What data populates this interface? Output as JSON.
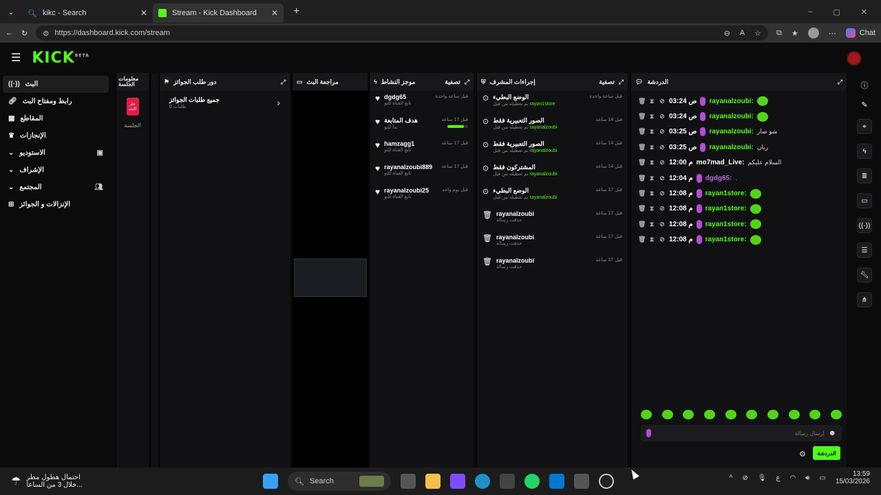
{
  "browser": {
    "tabs": [
      {
        "title": "kikc - Search",
        "active": false
      },
      {
        "title": "Stream - Kick Dashboard",
        "active": true
      }
    ],
    "url": "https://dashboard.kick.com/stream",
    "chat_label": "Chat"
  },
  "app": {
    "logo": "KICK",
    "logo_badge": "BETA",
    "nav": [
      {
        "label": "البث",
        "icon": "broadcast-icon",
        "active": true
      },
      {
        "label": "رابط ومفتاح البث",
        "icon": "link-icon"
      },
      {
        "label": "المقاطع",
        "icon": "clips-icon"
      },
      {
        "label": "الإنجازات",
        "icon": "trophy-icon"
      },
      {
        "label": "الاستوديو",
        "icon": "chevron-down-icon",
        "trail": "studio-icon"
      },
      {
        "label": "الإشراف",
        "icon": "chevron-down-icon"
      },
      {
        "label": "المجتمع",
        "icon": "chevron-down-icon",
        "trail": "users-icon"
      },
      {
        "label": "الإنزالات و الجوائز",
        "icon": "drops-icon"
      }
    ],
    "session_panel": {
      "title": "معلومات الجلسة",
      "badge": "حار البث",
      "label": "الجلسة"
    },
    "rewards_panel": {
      "title": "دور طلب الجوائز",
      "item_title": "جميع طلبات الجوائز",
      "item_sub": "0 طلبات"
    },
    "preview_panel": {
      "title": "مراجعة البث"
    },
    "activity_panel": {
      "title": "موجز النشاط",
      "filter": "تصفية",
      "items": [
        {
          "name": "dgdg65",
          "sub": "تابع القناة للتو",
          "time": "قبل ساعة واحدة"
        },
        {
          "name": "هدف المتابعة",
          "sub": "بدأ للتو",
          "time": "قبل 17 ساعة",
          "progress": 0.8
        },
        {
          "name": "hamzagg1",
          "sub": "تابع القناة للتو",
          "time": "قبل 17 ساعة"
        },
        {
          "name": "rayanalzoubi889",
          "sub": "تابع القناة للتو",
          "time": "قبل 17 ساعة"
        },
        {
          "name": "rayanalzoubi25",
          "sub": "تابع القناة للتو",
          "time": "قبل يوم واحد"
        }
      ]
    },
    "mod_panel": {
      "title": "إجراءات المشرف",
      "filter": "تصفية",
      "items": [
        {
          "title": "الوضع البطيء",
          "sub": "تم تعطيله من قبل",
          "user": "rayan1store",
          "time": "قبل ساعة واحدة"
        },
        {
          "title": "الصور التعبيرية فقط",
          "sub": "تم تعطيله من قبل",
          "user": "rayanalzoubi",
          "time": "قبل 14 ساعة"
        },
        {
          "title": "الصور التعبيرية فقط",
          "sub": "تم تعطيله من قبل",
          "user": "rayanalzoubi",
          "time": "قبل 14 ساعة"
        },
        {
          "title": "المشتركون فقط",
          "sub": "تم تعطيله من قبل",
          "user": "rayanalzoubi",
          "time": "قبل 14 ساعة"
        },
        {
          "title": "الوضع البطيء",
          "sub": "تم تعطيله من قبل",
          "user": "rayanalzoubi",
          "time": "قبل 17 ساعة"
        },
        {
          "title": "rayanalzoubi",
          "sub": "حذفت رسالة",
          "user": "",
          "time": "قبل 17 ساعة"
        },
        {
          "title": "rayanalzoubi",
          "sub": "حذفت رسالة",
          "user": "",
          "time": "قبل 17 ساعة"
        },
        {
          "title": "rayanalzoubi",
          "sub": "حذفت رسالة",
          "user": "",
          "time": "قبل 17 ساعة"
        }
      ]
    },
    "chat_panel": {
      "title": "الدردشة",
      "messages": [
        {
          "time": "03:24 ص",
          "user": "rayanalzoubi:",
          "color": "green",
          "msg": "",
          "emote": true
        },
        {
          "time": "03:24 ص",
          "user": "rayanalzoubi:",
          "color": "green",
          "msg": "",
          "emote": true
        },
        {
          "time": "03:25 ص",
          "user": "rayanalzoubi:",
          "color": "green",
          "msg": "شو صار",
          "emote": false
        },
        {
          "time": "03:25 ص",
          "user": "rayanalzoubi:",
          "color": "green",
          "msg": "ريان",
          "emote": false
        },
        {
          "time": "12:00 م",
          "user": "mo7mad_Live:",
          "color": "white",
          "msg": "السلام عليكم",
          "emote": false
        },
        {
          "time": "12:04 م",
          "user": "dgdg65:",
          "color": "purple",
          "msg": ".",
          "emote": false
        },
        {
          "time": "12:08 م",
          "user": "rayan1store:",
          "color": "green",
          "msg": "",
          "emote": true
        },
        {
          "time": "12:08 م",
          "user": "rayan1store:",
          "color": "green",
          "msg": "",
          "emote": true
        },
        {
          "time": "12:08 م",
          "user": "rayan1store:",
          "color": "green",
          "msg": "",
          "emote": true
        },
        {
          "time": "12:08 م",
          "user": "rayan1store:",
          "color": "green",
          "msg": "",
          "emote": true
        }
      ],
      "input_placeholder": "إرسال رسالة",
      "send_label": "الدردشة"
    }
  },
  "taskbar": {
    "weather_title": "احتمال هطول مطر",
    "weather_sub": "خلال 3 من الساعا...",
    "search_label": "Search",
    "time": "13:59",
    "date": "15/03/2026",
    "lang": "ع"
  },
  "colors": {
    "brand": "#53fc18",
    "purple": "#b56be0"
  }
}
